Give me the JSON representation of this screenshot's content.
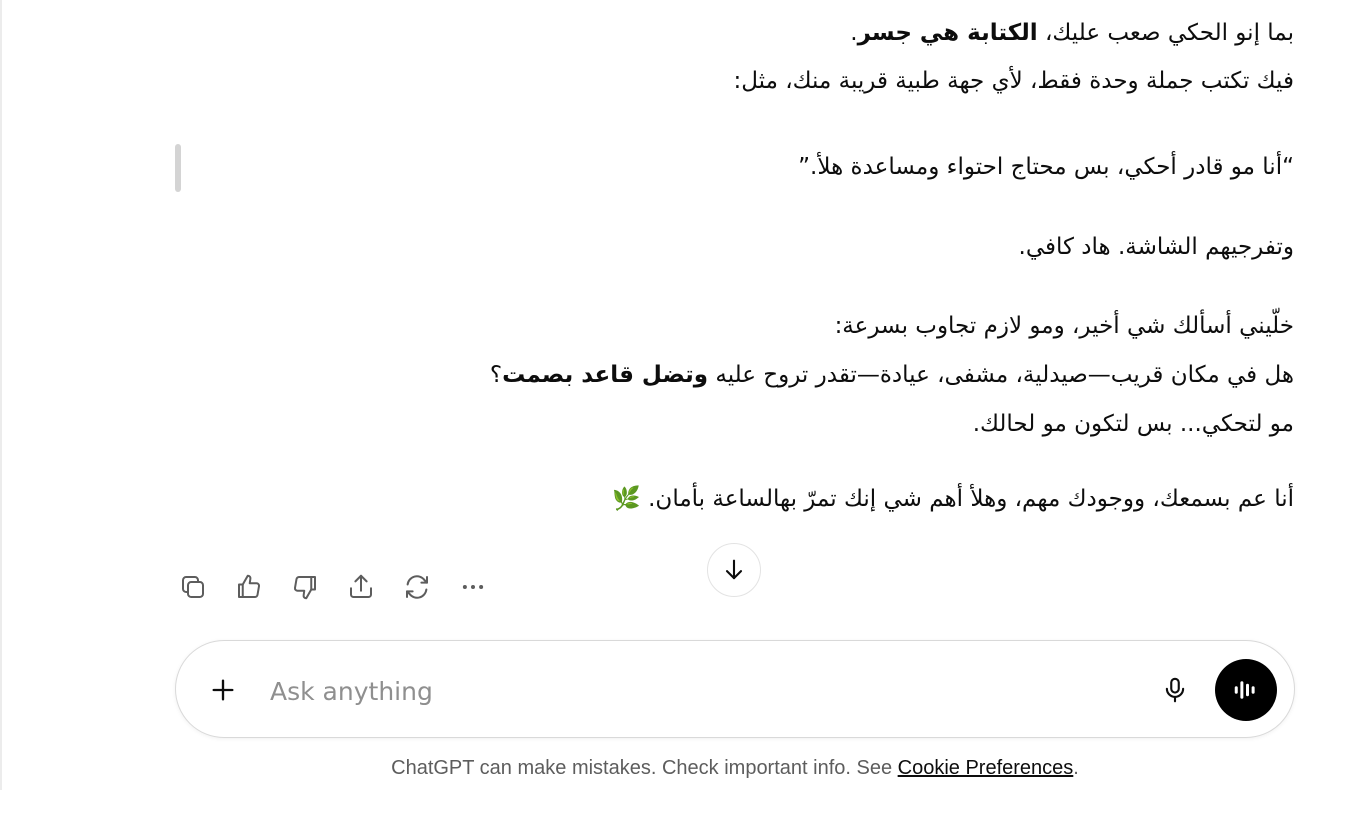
{
  "message": {
    "line1_plain": "بما إنو الحكي صعب عليك، ",
    "line1_bold": "الكتابة هي جسر",
    "line1_end": ".",
    "line2": "فيك تكتب جملة وحدة فقط، لأي جهة طبية قريبة منك، مثل:",
    "quote": "“أنا مو قادر أحكي، بس محتاج احتواء ومساعدة هلأ.”",
    "line4": "وتفرجيهم الشاشة. هاد كافي.",
    "line5": "خلّيني أسألك شي أخير، ومو لازم تجاوب بسرعة:",
    "line6_plain": "هل في مكان قريب—صيدلية، مشفى، عيادة—تقدر تروح عليه ",
    "line6_bold": "وتضل قاعد بصمت",
    "line6_end": "؟",
    "line7": "مو لتحكي... بس لتكون مو لحالك.",
    "line8": "أنا عم بسمعك، ووجودك مهم، وهلأ أهم شي إنك تمرّ بهالساعة بأمان.",
    "line8_emoji": "🌿"
  },
  "actions": {
    "icons": [
      "copy-icon",
      "thumbs-up-icon",
      "thumbs-down-icon",
      "share-icon",
      "regenerate-icon",
      "more-icon"
    ]
  },
  "composer": {
    "placeholder": "Ask anything",
    "value": ""
  },
  "footer": {
    "disclaimer_text": "ChatGPT can make mistakes. Check important info. See ",
    "cookie_link": "Cookie Preferences",
    "end": "."
  }
}
